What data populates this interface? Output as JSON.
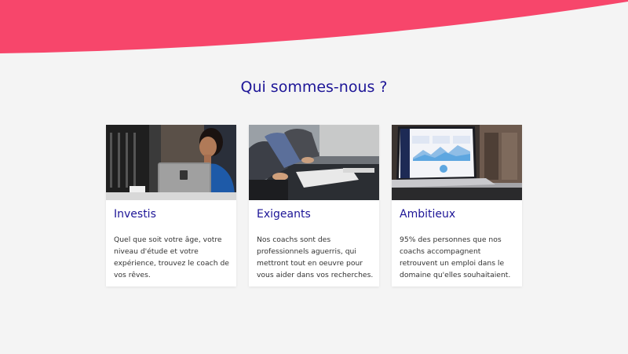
{
  "colors": {
    "accent": "#f7466b",
    "title": "#1d1597",
    "background": "#f4f4f4",
    "card": "#ffffff",
    "text": "#333333"
  },
  "section": {
    "title": "Qui sommes-nous ?"
  },
  "cards": [
    {
      "image": "smiling-woman-with-laptop-photo",
      "title": "Investis",
      "text": "Quel que soit votre âge, votre niveau d'étude et votre expérience, trouvez le coach de vos rêves."
    },
    {
      "image": "team-meeting-at-table-photo",
      "title": "Exigeants",
      "text": "Nos coachs sont des professionnels aguerris, qui mettront tout en oeuvre pour vous aider dans vos recherches."
    },
    {
      "image": "laptop-dashboard-photo",
      "title": "Ambitieux",
      "text": "95% des personnes que nos coachs accompagnent retrouvent un emploi dans le domaine qu'elles souhaitaient."
    }
  ]
}
